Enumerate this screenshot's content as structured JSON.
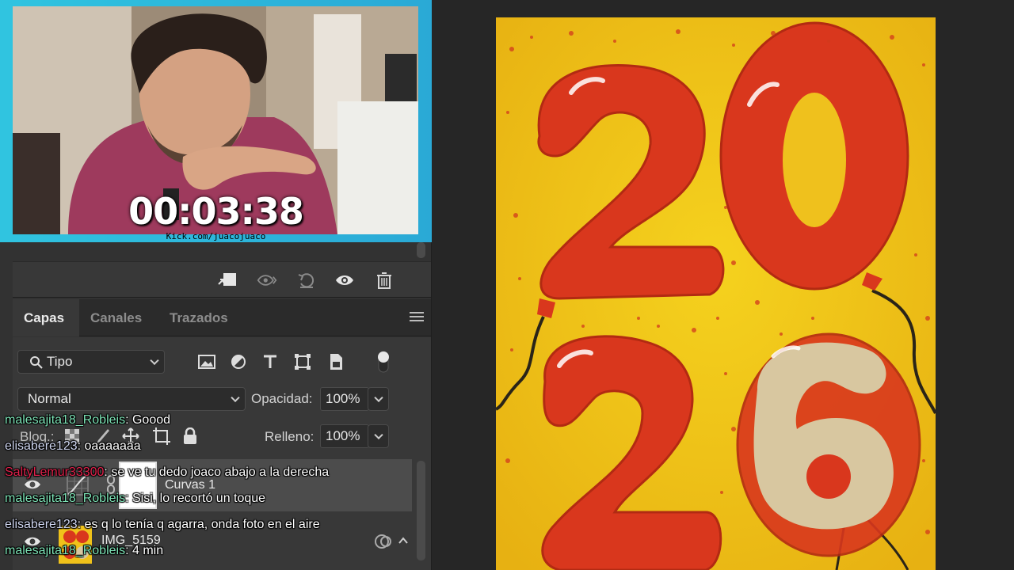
{
  "stream": {
    "timer": "00:03:38",
    "url": "Kick.com/juacojuaco"
  },
  "layers_panel": {
    "tabs": [
      {
        "label": "Capas",
        "active": true
      },
      {
        "label": "Canales",
        "active": false
      },
      {
        "label": "Trazados",
        "active": false
      }
    ],
    "filter": {
      "selected": "Tipo"
    },
    "blend_mode": "Normal",
    "opacity_label": "Opacidad:",
    "opacity_value": "100%",
    "lock_label": "Bloq.:",
    "fill_label": "Relleno:",
    "fill_value": "100%",
    "layers": [
      {
        "name": "Curvas 1",
        "type": "adjustment",
        "visible": true,
        "selected": true
      },
      {
        "name": "IMG_5159",
        "type": "image",
        "visible": true,
        "selected": false
      }
    ]
  },
  "chat": [
    {
      "user": "malesajita18_Robleis",
      "message": "Goood",
      "color": "#7de3b6"
    },
    {
      "user": "elisabere123",
      "message": "oaaaaaaa",
      "color": "#cfd6f0"
    },
    {
      "user": "SaltyLemur33300",
      "message": "se ve tu dedo joaco abajo a la derecha",
      "color": "#e0214b"
    },
    {
      "user": "malesajita18_Robleis",
      "message": "Sisi, lo recortó un toque",
      "color": "#7de3b6"
    },
    {
      "user": "elisabere123",
      "message": "es q lo tenía q agarra, onda foto en el aire",
      "color": "#cfd6f0"
    },
    {
      "user": "malesajita18_Robleis",
      "message": "4 min",
      "color": "#7de3b6"
    }
  ],
  "artwork": {
    "digits": [
      "2",
      "0",
      "2",
      "6"
    ],
    "background_color": "#f1c21a",
    "balloon_color": "#d9371d",
    "six_color": "#d8c7a0"
  }
}
